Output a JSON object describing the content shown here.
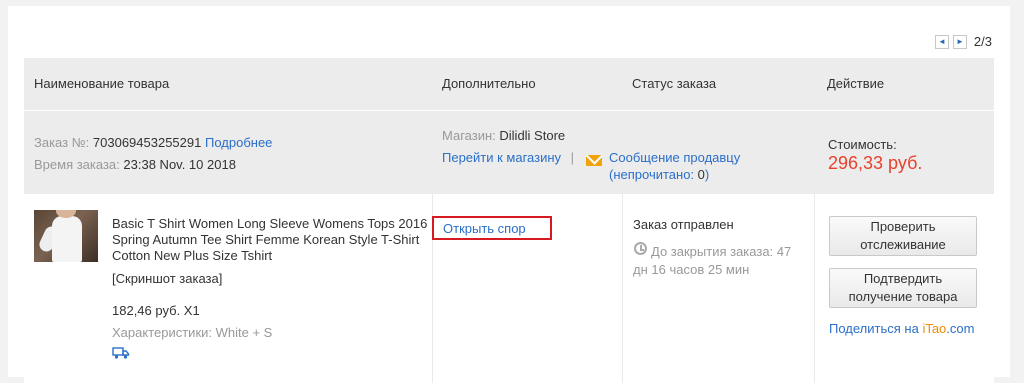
{
  "pager": {
    "prev": "◄",
    "next": "►",
    "page": "2/3"
  },
  "header": {
    "col_name": "Наименование товара",
    "col_extra": "Дополнительно",
    "col_status": "Статус заказа",
    "col_action": "Действие"
  },
  "order": {
    "number_label": "Заказ №:",
    "number_value": "703069453255291",
    "details_link": "Подробнее",
    "time_label": "Время заказа:",
    "time_value": "23:38 Nov. 10 2018",
    "store_label": "Магазин:",
    "store_name": "Dilidli Store",
    "go_to_store": "Перейти к магазину",
    "separator": "|",
    "message_seller": "Сообщение продавцу",
    "unread_prefix": "(непрочитано:",
    "unread_count": "0",
    "unread_suffix": ")",
    "cost_label": "Стоимость:",
    "cost_value": "296,33 руб."
  },
  "item": {
    "title": "Basic T Shirt Women Long Sleeve Womens Tops 2016 Spring Autumn Tee Shirt Femme Korean Style T-Shirt Cotton New Plus Size Tshirt",
    "snapshot": "[Скриншот заказа]",
    "price": "182,46 руб. X1",
    "props_label": "Характеристики:",
    "props_value": "White + S",
    "open_dispute": "Открыть спор",
    "status": "Заказ отправлен",
    "countdown_line1": "До закрытия заказа: 47",
    "countdown_line2": "дн 16 часов 25 мин",
    "btn_track_line1": "Проверить",
    "btn_track_line2": "отслеживание",
    "btn_confirm_line1": "Подтвердить",
    "btn_confirm_line2": "получение товара",
    "share_prefix": "Поделиться на",
    "share_brand_i": "iTao",
    "share_brand_rest": ".com"
  },
  "colors": {
    "link": "#2b6fc9",
    "price": "#e8412c",
    "dispute_border": "#d71921",
    "mail": "#f0a30a"
  },
  "icons": [
    "prev-arrow-icon",
    "next-arrow-icon",
    "mail-icon",
    "clock-icon",
    "truck-icon"
  ]
}
